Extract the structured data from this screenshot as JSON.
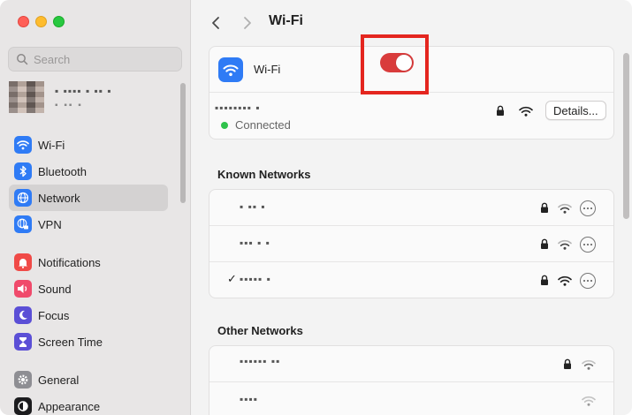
{
  "window": {
    "title": "Wi-Fi"
  },
  "sidebar": {
    "search": {
      "placeholder": "Search"
    },
    "account": {
      "name": "▪ ▪▪▪▪ ▪ ▪▪ ▪",
      "subtitle": "▪ ▪▪ ▪"
    },
    "items": [
      {
        "label": "Wi-Fi",
        "icon": "wifi-icon",
        "color": "#2f7bf5"
      },
      {
        "label": "Bluetooth",
        "icon": "bluetooth-icon",
        "color": "#2f7bf5"
      },
      {
        "label": "Network",
        "icon": "globe-icon",
        "color": "#2f7bf5",
        "selected": true
      },
      {
        "label": "VPN",
        "icon": "globe-lock-icon",
        "color": "#2f7bf5"
      },
      {
        "label": "Notifications",
        "icon": "bell-icon",
        "color": "#f04a47"
      },
      {
        "label": "Sound",
        "icon": "speaker-icon",
        "color": "#f04a6b"
      },
      {
        "label": "Focus",
        "icon": "moon-icon",
        "color": "#5b4fd6"
      },
      {
        "label": "Screen Time",
        "icon": "hourglass-icon",
        "color": "#5b4fd6"
      },
      {
        "label": "General",
        "icon": "gear-icon",
        "color": "#8e8e93"
      },
      {
        "label": "Appearance",
        "icon": "appearance-icon",
        "color": "#1c1c1e"
      }
    ]
  },
  "main": {
    "title": "Wi-Fi",
    "wifi_card": {
      "label": "Wi-Fi",
      "toggle_on": true,
      "current_network": "▪▪▪▪▪▪▪▪ ▪",
      "status": "Connected",
      "details_label": "Details..."
    },
    "known_networks": {
      "title": "Known Networks",
      "items": [
        {
          "name": "▪ ▪▪  ▪",
          "connected": false
        },
        {
          "name": "▪▪▪ ▪ ▪",
          "connected": false
        },
        {
          "name": "▪▪▪▪▪ ▪",
          "connected": true,
          "check": "✓"
        }
      ]
    },
    "other_networks": {
      "title": "Other Networks",
      "items": [
        {
          "name": "▪▪▪▪▪▪ ▪▪",
          "locked": true
        },
        {
          "name": "▪▪▪▪",
          "locked": false
        }
      ]
    }
  },
  "colors": {
    "accent": "#2f7bf5",
    "toggle": "#d93c3c",
    "highlight": "#e4261f",
    "connected": "#2fc24b"
  }
}
